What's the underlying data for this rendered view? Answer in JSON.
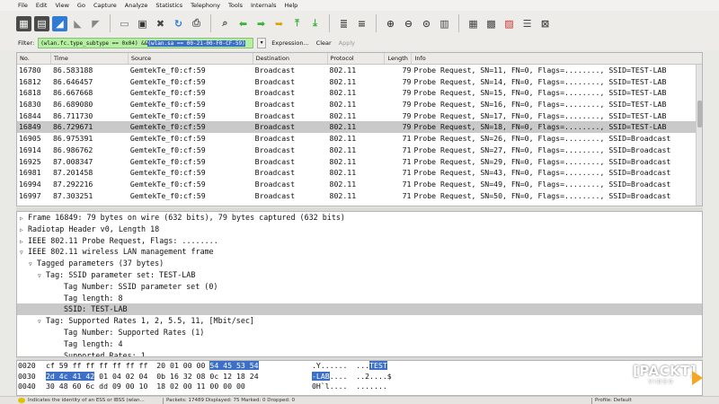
{
  "menu": [
    "File",
    "Edit",
    "View",
    "Go",
    "Capture",
    "Analyze",
    "Statistics",
    "Telephony",
    "Tools",
    "Internals",
    "Help"
  ],
  "filter": {
    "label": "Filter:",
    "value_plain": "(wlan.fc.type_subtype == 0x04) && ",
    "value_selected": "(wlan.sa == 00-21-00-F0-CF-59)",
    "expression": "Expression...",
    "clear": "Clear",
    "apply": "Apply",
    "color": "#b5f0a2"
  },
  "packet_list": {
    "columns": [
      "No.",
      "Time",
      "Source",
      "Destination",
      "Protocol",
      "Length",
      "Info"
    ],
    "rows": [
      {
        "no": "16780",
        "time": "86.583188",
        "src": "GemtekTe_f0:cf:59",
        "dst": "Broadcast",
        "proto": "802.11",
        "len": "79",
        "info": "Probe Request, SN=11, FN=0, Flags=........, SSID=TEST-LAB"
      },
      {
        "no": "16812",
        "time": "86.646457",
        "src": "GemtekTe_f0:cf:59",
        "dst": "Broadcast",
        "proto": "802.11",
        "len": "79",
        "info": "Probe Request, SN=14, FN=0, Flags=........, SSID=TEST-LAB"
      },
      {
        "no": "16818",
        "time": "86.667668",
        "src": "GemtekTe_f0:cf:59",
        "dst": "Broadcast",
        "proto": "802.11",
        "len": "79",
        "info": "Probe Request, SN=15, FN=0, Flags=........, SSID=TEST-LAB"
      },
      {
        "no": "16830",
        "time": "86.689080",
        "src": "GemtekTe_f0:cf:59",
        "dst": "Broadcast",
        "proto": "802.11",
        "len": "79",
        "info": "Probe Request, SN=16, FN=0, Flags=........, SSID=TEST-LAB"
      },
      {
        "no": "16844",
        "time": "86.711730",
        "src": "GemtekTe_f0:cf:59",
        "dst": "Broadcast",
        "proto": "802.11",
        "len": "79",
        "info": "Probe Request, SN=17, FN=0, Flags=........, SSID=TEST-LAB"
      },
      {
        "no": "16849",
        "time": "86.729671",
        "src": "GemtekTe_f0:cf:59",
        "dst": "Broadcast",
        "proto": "802.11",
        "len": "79",
        "info": "Probe Request, SN=18, FN=0, Flags=........, SSID=TEST-LAB"
      },
      {
        "no": "16905",
        "time": "86.975391",
        "src": "GemtekTe_f0:cf:59",
        "dst": "Broadcast",
        "proto": "802.11",
        "len": "71",
        "info": "Probe Request, SN=26, FN=0, Flags=........, SSID=Broadcast"
      },
      {
        "no": "16914",
        "time": "86.986762",
        "src": "GemtekTe_f0:cf:59",
        "dst": "Broadcast",
        "proto": "802.11",
        "len": "71",
        "info": "Probe Request, SN=27, FN=0, Flags=........, SSID=Broadcast"
      },
      {
        "no": "16925",
        "time": "87.008347",
        "src": "GemtekTe_f0:cf:59",
        "dst": "Broadcast",
        "proto": "802.11",
        "len": "71",
        "info": "Probe Request, SN=29, FN=0, Flags=........, SSID=Broadcast"
      },
      {
        "no": "16981",
        "time": "87.201458",
        "src": "GemtekTe_f0:cf:59",
        "dst": "Broadcast",
        "proto": "802.11",
        "len": "71",
        "info": "Probe Request, SN=43, FN=0, Flags=........, SSID=Broadcast"
      },
      {
        "no": "16994",
        "time": "87.292216",
        "src": "GemtekTe_f0:cf:59",
        "dst": "Broadcast",
        "proto": "802.11",
        "len": "71",
        "info": "Probe Request, SN=49, FN=0, Flags=........, SSID=Broadcast"
      },
      {
        "no": "16997",
        "time": "87.303251",
        "src": "GemtekTe_f0:cf:59",
        "dst": "Broadcast",
        "proto": "802.11",
        "len": "71",
        "info": "Probe Request, SN=50, FN=0, Flags=........, SSID=Broadcast"
      }
    ],
    "selected_index": 5
  },
  "details": [
    {
      "text": "Frame 16849: 79 bytes on wire (632 bits), 79 bytes captured (632 bits)",
      "arrow": "collapsed"
    },
    {
      "text": "Radiotap Header v0, Length 18",
      "arrow": "collapsed"
    },
    {
      "text": "IEEE 802.11 Probe Request, Flags: ........",
      "arrow": "collapsed"
    },
    {
      "text": "IEEE 802.11 wireless LAN management frame",
      "arrow": "expanded"
    },
    {
      "text": "Tagged parameters (37 bytes)",
      "arrow": "expanded"
    },
    {
      "text": "Tag: SSID parameter set: TEST-LAB",
      "arrow": "expanded"
    },
    {
      "text": "Tag Number: SSID parameter set (0)",
      "arrow": "none"
    },
    {
      "text": "Tag length: 8",
      "arrow": "none"
    },
    {
      "text": "SSID: TEST-LAB",
      "arrow": "none",
      "selected": true
    },
    {
      "text": "Tag: Supported Rates 1, 2, 5.5, 11, [Mbit/sec]",
      "arrow": "expanded"
    },
    {
      "text": "Tag Number: Supported Rates (1)",
      "arrow": "none"
    },
    {
      "text": "Tag length: 4",
      "arrow": "none"
    },
    {
      "text": "Supported Rates: 1",
      "arrow": "none"
    }
  ],
  "hex": [
    {
      "offset": "0020",
      "bytes_a": "cf 59 ff ff ff ff ff ff  20 01 00 00 ",
      "bytes_b": "54 45 53 54",
      "ascii_a": ".Y......  ...",
      "ascii_b": "TEST"
    },
    {
      "offset": "0030",
      "bytes_sel": "2d 4c 41 42",
      "bytes_rest": " 01 04 02 04  0b 16 32 08 0c 12 18 24",
      "ascii_sel": "-LAB",
      "ascii_rest": "....  ..2....$"
    },
    {
      "offset": "0040",
      "bytes": "30 48 60 6c dd 09 00 10  18 02 00 11 00 00 00",
      "ascii": "0H`l....  ......."
    }
  ],
  "status": {
    "left": "Indicates the identity of an ESS or IBSS (wlan...",
    "middle": "Packets: 17489 Displayed: 75 Marked: 0 Dropped: 0",
    "right": "Profile: Default"
  },
  "watermark": {
    "brand": "[PACKT]",
    "sub": "VIDEO",
    "accent": "#f5a623"
  }
}
